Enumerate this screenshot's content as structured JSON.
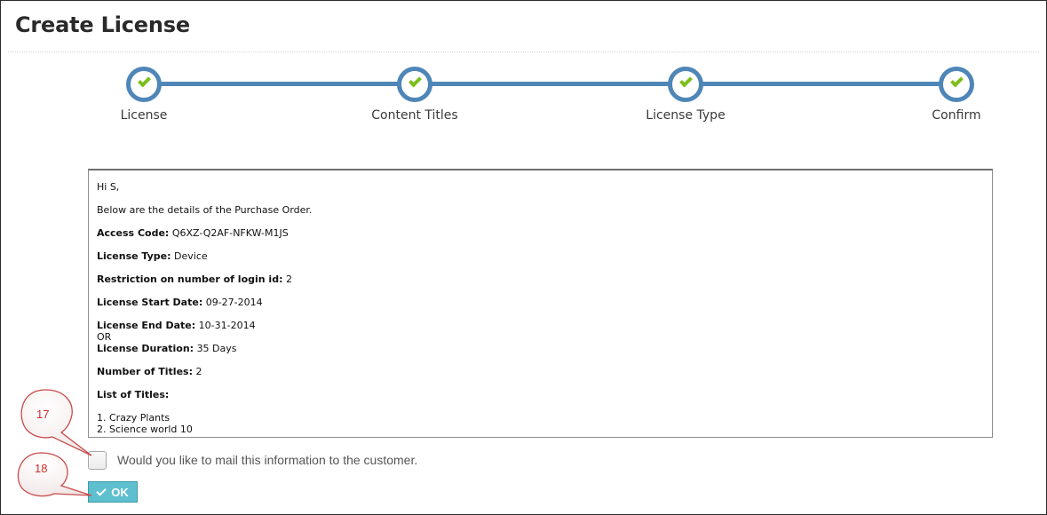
{
  "page": {
    "title": "Create License"
  },
  "wizard": {
    "accent_color": "#4f86b8",
    "check_color": "#7cbf1b",
    "steps": [
      {
        "label": "License",
        "status": "complete"
      },
      {
        "label": "Content Titles",
        "status": "complete"
      },
      {
        "label": "License Type",
        "status": "complete"
      },
      {
        "label": "Confirm",
        "status": "complete"
      }
    ]
  },
  "details": {
    "greeting": "Hi S,",
    "intro": "Below are the details of the Purchase Order.",
    "access_code_label": "Access Code:",
    "access_code_value": "Q6XZ-Q2AF-NFKW-M1JS",
    "license_type_label": "License Type:",
    "license_type_value": "Device",
    "restriction_label": "Restriction on number of login id:",
    "restriction_value": "2",
    "start_date_label": "License Start Date:",
    "start_date_value": "09-27-2014",
    "end_date_label": "License End Date:",
    "end_date_value": "10-31-2014",
    "or_text": "OR",
    "duration_label": "License Duration:",
    "duration_value": "35 Days",
    "num_titles_label": "Number of Titles:",
    "num_titles_value": "2",
    "list_label": "List of Titles:",
    "titles": [
      "1. Crazy Plants",
      "2. Science world 10"
    ]
  },
  "mail_option": {
    "label": "Would you like to mail this information to the customer.",
    "checked": false
  },
  "ok_button": {
    "label": "OK",
    "color": "#5ec0cf"
  },
  "callouts": [
    {
      "number": "17",
      "color": "#d62b2b"
    },
    {
      "number": "18",
      "color": "#d62b2b"
    }
  ]
}
